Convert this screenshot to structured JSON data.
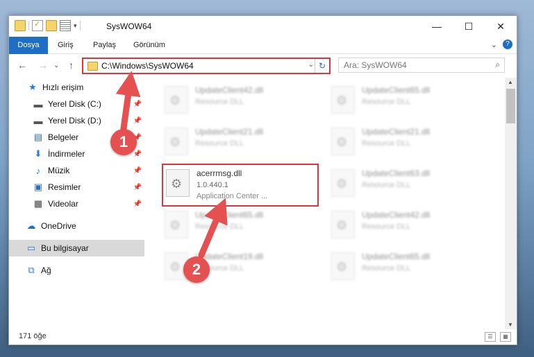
{
  "window": {
    "title": "SysWOW64",
    "controls": {
      "minimize": "—",
      "maximize": "☐",
      "close": "✕"
    }
  },
  "ribbon": {
    "tabs": [
      "Dosya",
      "Giriş",
      "Paylaş",
      "Görünüm"
    ],
    "expand": "⌄",
    "help": "?"
  },
  "nav": {
    "back": "←",
    "forward": "→",
    "recent": "⌄",
    "up": "↑",
    "address": "C:\\Windows\\SysWOW64",
    "address_dropdown": "⌄",
    "refresh": "↻",
    "search_placeholder": "Ara: SysWOW64",
    "search_icon": "⌕"
  },
  "sidebar": {
    "quick_access": "Hızlı erişim",
    "items": [
      {
        "label": "Yerel Disk (C:)",
        "icon": "drive-icon",
        "pinned": true
      },
      {
        "label": "Yerel Disk (D:)",
        "icon": "drive-icon",
        "pinned": true
      },
      {
        "label": "Belgeler",
        "icon": "documents-icon",
        "pinned": true
      },
      {
        "label": "İndirmeler",
        "icon": "downloads-icon",
        "pinned": true
      },
      {
        "label": "Müzik",
        "icon": "music-icon",
        "pinned": true
      },
      {
        "label": "Resimler",
        "icon": "pictures-icon",
        "pinned": true
      },
      {
        "label": "Videolar",
        "icon": "videos-icon",
        "pinned": true
      }
    ],
    "onedrive": "OneDrive",
    "this_pc": "Bu bilgisayar",
    "network": "Ağ",
    "pin_glyph": "📌"
  },
  "files": [
    {
      "name": "UpdateClient42.dll",
      "line2": "Resource DLL",
      "line3": ""
    },
    {
      "name": "UpdateClient65.dll",
      "line2": "Resource DLL",
      "line3": ""
    },
    {
      "name": "UpdateClient21.dll",
      "line2": "Resource DLL",
      "line3": ""
    },
    {
      "name": "UpdateClient21.dll",
      "line2": "Resource DLL",
      "line3": ""
    },
    {
      "name": "acerrmsg.dll",
      "line2": "1.0.440.1",
      "line3": "Application Center ..."
    },
    {
      "name": "UpdateClient63.dll",
      "line2": "Resource DLL",
      "line3": ""
    },
    {
      "name": "UpdateClient65.dll",
      "line2": "Resource DLL",
      "line3": ""
    },
    {
      "name": "UpdateClient42.dll",
      "line2": "Resource DLL",
      "line3": ""
    },
    {
      "name": "UpdateClient19.dll",
      "line2": "Resource DLL",
      "line3": ""
    },
    {
      "name": "UpdateClient65.dll",
      "line2": "Resource DLL",
      "line3": ""
    }
  ],
  "status": {
    "count": "171 öğe"
  },
  "annotations": {
    "marker1": "1",
    "marker2": "2",
    "highlight_color": "#e0343a",
    "marker_color": "#e55050"
  },
  "colors": {
    "accent": "#1e6fc3"
  }
}
